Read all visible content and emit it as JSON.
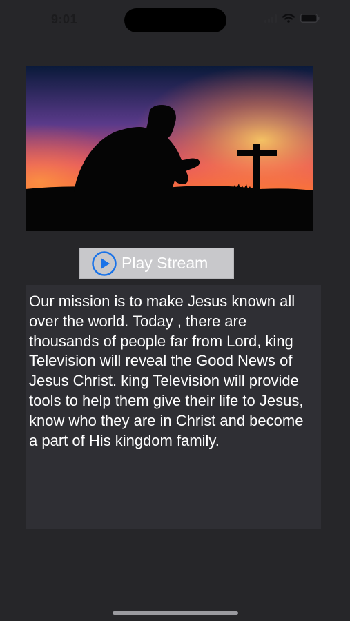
{
  "status_bar": {
    "time": "9:01",
    "icons": [
      "signal-icon",
      "wifi-icon",
      "battery-icon"
    ]
  },
  "hero": {
    "image": "praying-silhouette-with-cross-at-sunset"
  },
  "player": {
    "play_label": "Play Stream",
    "icon": "play-circle-icon",
    "accent_color": "#1a73e8"
  },
  "mission": {
    "text": "Our mission is to make Jesus known all over the world. Today , there are thousands of people far from Lord, king Television will reveal the Good News of Jesus Christ. king Television will provide tools to help them give their life to Jesus, know who they are in Christ and become a part of His kingdom family."
  },
  "colors": {
    "background": "#262629",
    "text_panel": "#2f2f34",
    "button": "#c8c8cb"
  }
}
